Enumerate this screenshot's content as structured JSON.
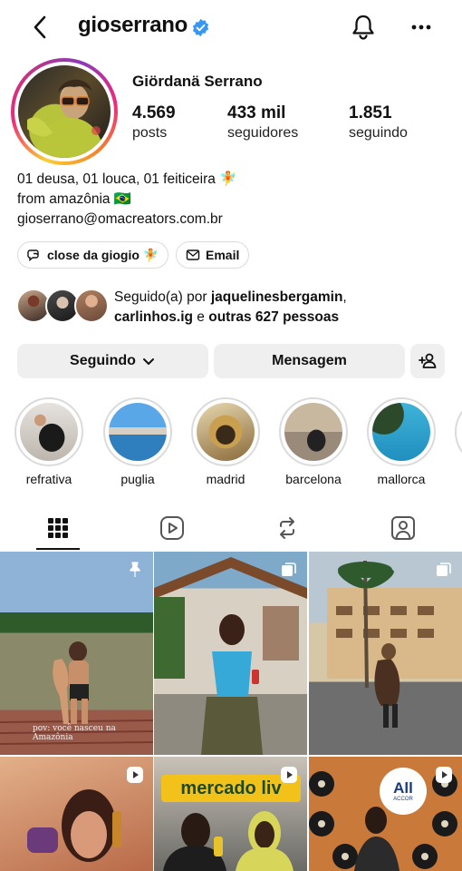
{
  "header": {
    "username": "gioserrano",
    "icons": {
      "back": "chevron-left-icon",
      "verified": "verified-badge-icon",
      "notifications": "bell-icon",
      "more": "more-horizontal-icon"
    }
  },
  "profile": {
    "full_name": "Giördanä Serrano",
    "stats": [
      {
        "value": "4.569",
        "label": "posts"
      },
      {
        "value": "433 mil",
        "label": "seguidores"
      },
      {
        "value": "1.851",
        "label": "seguindo"
      }
    ],
    "bio": [
      "01 deusa, 01 louca, 01 feiticeira 🧚",
      "from amazônia 🇧🇷",
      "gioserrano@omacreators.com.br"
    ],
    "chips": [
      {
        "label": "close da giogio 🧚",
        "icon": "close-friends-icon"
      },
      {
        "label": "Email",
        "icon": "mail-icon"
      }
    ],
    "followed_by": {
      "prefix": "Seguido(a) por ",
      "user1": "jaquelinesbergamin",
      "sep": ",",
      "user2": "carlinhos.ig",
      "middle": " e ",
      "others": "outras 627 pessoas"
    }
  },
  "actions": {
    "following": "Seguindo",
    "message": "Mensagem",
    "following_icon": "chevron-down-icon",
    "add_user_icon": "add-person-icon"
  },
  "highlights": [
    {
      "label": "refrativa"
    },
    {
      "label": "puglia"
    },
    {
      "label": "madrid"
    },
    {
      "label": "barcelona"
    },
    {
      "label": "mallorca"
    }
  ],
  "tabs": [
    {
      "name": "grid",
      "icon": "grid-icon",
      "active": true
    },
    {
      "name": "reels",
      "icon": "reels-icon",
      "active": false
    },
    {
      "name": "reposts",
      "icon": "repost-icon",
      "active": false
    },
    {
      "name": "tagged",
      "icon": "tagged-icon",
      "active": false
    }
  ],
  "posts": [
    {
      "overlay_icon": "pin-icon",
      "caption": "pov: você nasceu na Amazônia"
    },
    {
      "overlay_icon": "carousel-icon"
    },
    {
      "overlay_icon": "carousel-icon"
    },
    {
      "overlay_icon": "reel-icon"
    },
    {
      "overlay_icon": "reel-icon",
      "sign_text": "mercado liv"
    },
    {
      "overlay_icon": "reel-icon",
      "badge_text": "All",
      "badge_sub": "ACCOR"
    }
  ],
  "colors": {
    "accent": "#3897f0",
    "button_bg": "#efefef",
    "ring_gray": "#dbdbdb"
  }
}
